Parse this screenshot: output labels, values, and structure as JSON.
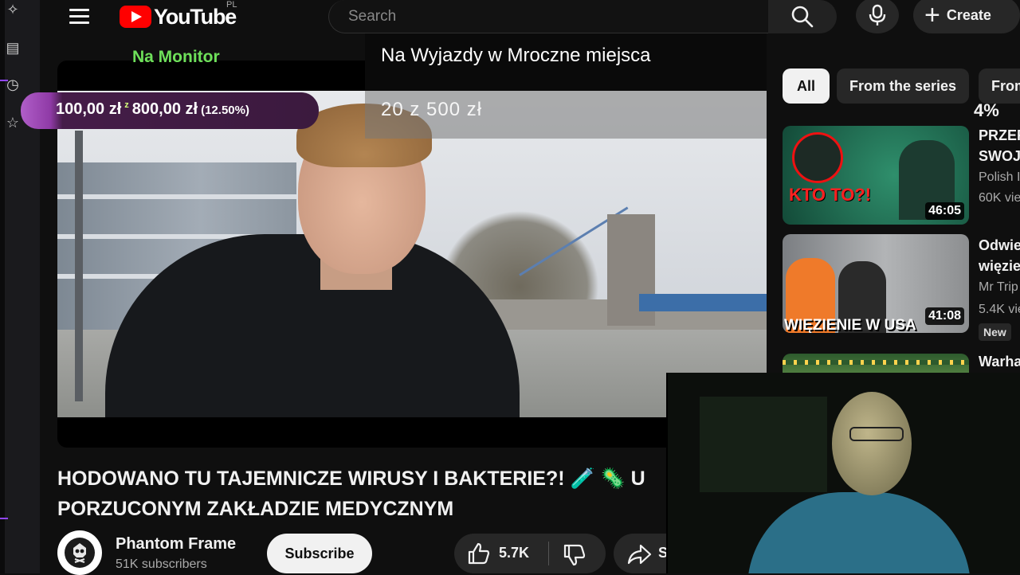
{
  "header": {
    "logo_text": "YouTube",
    "logo_region": "PL",
    "search_placeholder": "Search",
    "create_label": "Create"
  },
  "overlay": {
    "monitor_label": "Na Monitor",
    "goal_title": "Na Wyjazdy w Mroczne miejsca",
    "goal_progress_text": "20 z 500 zł",
    "goal_amount": "100,00 zł",
    "goal_separator": "z",
    "goal_target": "800,00 zł",
    "goal_percent": "(12.50%)"
  },
  "video": {
    "title": "HODOWANO TU TAJEMNICZE WIRUSY I BAKTERIE?! 🧪 🦠 U PORZUCONYM ZAKŁADZIE MEDYCZNYM",
    "channel_name": "Phantom Frame",
    "subscribers": "51K subscribers",
    "subscribe_label": "Subscribe",
    "likes": "5.7K",
    "share_label": "S"
  },
  "related": {
    "chips": [
      "All",
      "From the series",
      "From"
    ],
    "percent_label": "4%",
    "items": [
      {
        "title": "PRZER",
        "title2": "SWOJ",
        "channel": "Polish I",
        "views": "60K vie",
        "duration": "46:05",
        "thumb_text": "KTO TO?!"
      },
      {
        "title": "Odwie",
        "title2": "więzie",
        "channel": "Mr Trip",
        "views": "5.4K vie",
        "duration": "41:08",
        "thumb_text": "WIĘZIENIE W USA",
        "badge": "New"
      },
      {
        "title": "Warha"
      }
    ]
  },
  "colors": {
    "youtube_red": "#ff0000",
    "monitor_green": "#6ee05a",
    "goal_purple": "#9146ff"
  }
}
